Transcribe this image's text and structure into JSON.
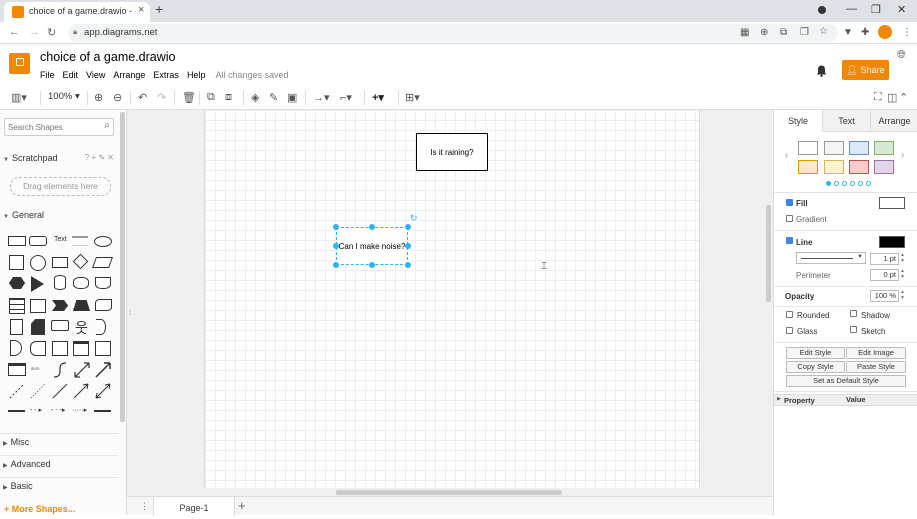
{
  "browser": {
    "tab_title": "choice of a game.drawio - diagrams.net",
    "tab_close": "×",
    "new_tab": "+",
    "url": "app.diagrams.net",
    "nav": {
      "back": "←",
      "forward": "→",
      "reload": "↻"
    },
    "window_controls": {
      "minimize": "—",
      "maximize": "❐",
      "close": "✕"
    }
  },
  "app": {
    "doc_title": "choice of a game.drawio",
    "menu": [
      "File",
      "Edit",
      "View",
      "Arrange",
      "Extras",
      "Help"
    ],
    "save_status": "All changes saved",
    "share_label": "Share",
    "accent": "#f08705"
  },
  "toolbar": {
    "zoom": "100%"
  },
  "shapes_panel": {
    "search_placeholder": "Search Shapes",
    "scratchpad": "Scratchpad",
    "scratchpad_icons": "? + ✎ ✕",
    "drag_hint": "Drag elements here",
    "general": "General",
    "text_shape": "Text",
    "sections": [
      "Misc",
      "Advanced",
      "Basic"
    ],
    "more_shapes": "+ More Shapes..."
  },
  "canvas": {
    "node1_label": "Is it raining?",
    "node2_label": "Can I make noise?",
    "selection_color": "#29b6f2"
  },
  "pages": {
    "current": "Page-1",
    "menu_icon": "⋮",
    "add": "+"
  },
  "format_panel": {
    "tabs": [
      "Style",
      "Text",
      "Arrange"
    ],
    "swatches": [
      "#ffffff",
      "#f5f5f5",
      "#dae8fc",
      "#d5e8d4",
      "#ffe6cc",
      "#fff2cc",
      "#f8cecc",
      "#e1d5e7"
    ],
    "fill_label": "Fill",
    "gradient_label": "Gradient",
    "line_label": "Line",
    "line_width": "1 pt",
    "perimeter_label": "Perimeter",
    "perimeter_value": "0 pt",
    "opacity_label": "Opacity",
    "opacity_value": "100 %",
    "rounded": "Rounded",
    "shadow": "Shadow",
    "glass": "Glass",
    "sketch": "Sketch",
    "edit_style": "Edit Style",
    "edit_image": "Edit Image",
    "copy_style": "Copy Style",
    "paste_style": "Paste Style",
    "set_default": "Set as Default Style",
    "property_header": "Property",
    "value_header": "Value"
  }
}
